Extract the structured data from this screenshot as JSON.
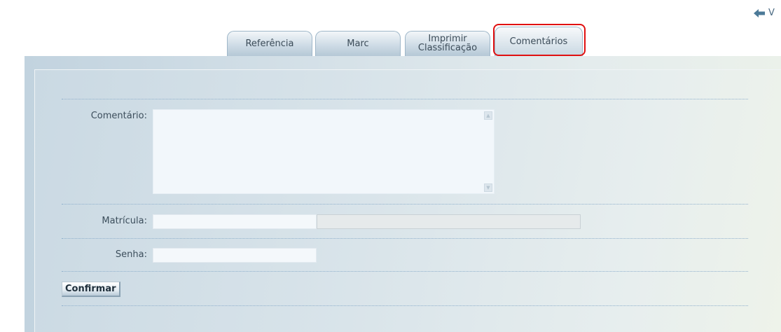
{
  "top_link": {
    "text": "V",
    "icon": "back-arrow-icon"
  },
  "tabs": [
    {
      "label": "Referência"
    },
    {
      "label": "Marc"
    },
    {
      "label_line1": "Imprimir",
      "label_line2": "Classificação"
    },
    {
      "label": "Comentários",
      "active": true
    }
  ],
  "form": {
    "comment_label": "Comentário:",
    "comment_value": "",
    "matricula_label": "Matrícula:",
    "matricula_value": "",
    "matricula_name_value": "",
    "senha_label": "Senha:",
    "senha_value": "",
    "confirm_label": "Confirmar"
  },
  "colors": {
    "highlight": "#e01010",
    "panel": "#d5e1e8"
  }
}
